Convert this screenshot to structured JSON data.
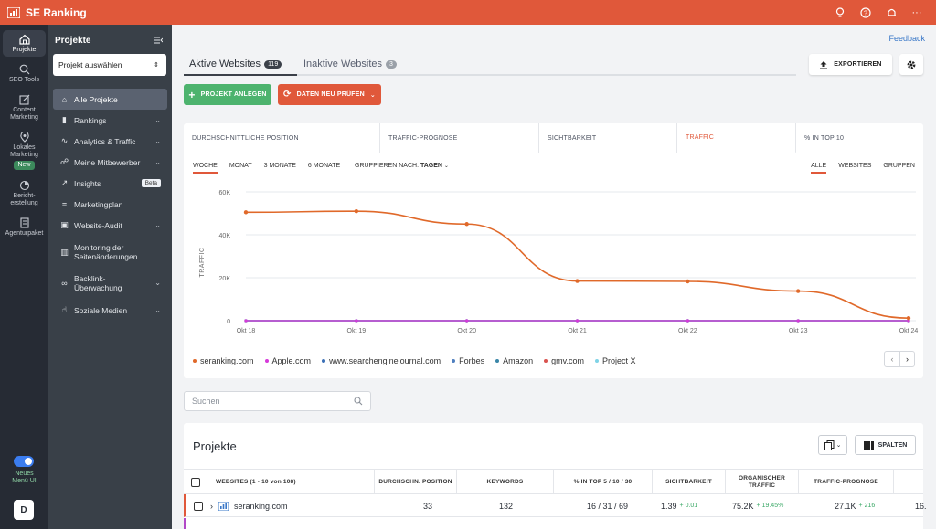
{
  "app": {
    "title": "SE Ranking"
  },
  "rail": {
    "items": [
      {
        "label": "Projekte",
        "icon": "home-icon"
      },
      {
        "label": "SEO Tools",
        "icon": "search-icon"
      },
      {
        "label": "Content Marketing",
        "icon": "edit-icon"
      },
      {
        "label": "Lokales Marketing",
        "icon": "pin-icon",
        "badge": "New"
      },
      {
        "label": "Bericht-erstellung",
        "icon": "pie-icon"
      },
      {
        "label": "Agenturpaket",
        "icon": "building-icon"
      }
    ],
    "new_ui": "Neues Menü UI",
    "avatar": "D"
  },
  "sidebar": {
    "title": "Projekte",
    "select": "Projekt auswählen",
    "items": [
      {
        "label": "Alle Projekte"
      },
      {
        "label": "Rankings"
      },
      {
        "label": "Analytics & Traffic"
      },
      {
        "label": "Meine Mitbewerber"
      },
      {
        "label": "Insights",
        "badge": "Beta"
      },
      {
        "label": "Marketingplan"
      },
      {
        "label": "Website-Audit"
      },
      {
        "label": "Monitoring der Seitenänderungen"
      },
      {
        "label": "Backlink-Überwachung"
      },
      {
        "label": "Soziale Medien"
      }
    ]
  },
  "main": {
    "feedback": "Feedback",
    "tabs": [
      {
        "label": "Aktive Websites",
        "count": "119"
      },
      {
        "label": "Inaktive Websites",
        "count": "3"
      }
    ],
    "export": "EXPORTIEREN",
    "add_project": "PROJEKT ANLEGEN",
    "recheck": "DATEN NEU PRÜFEN",
    "metric_tabs": [
      "DURCHSCHNITTLICHE POSITION",
      "TRAFFIC-PROGNOSE",
      "SICHTBARKEIT",
      "TRAFFIC",
      "% IN TOP 10"
    ],
    "periods": [
      "WOCHE",
      "MONAT",
      "3 MONATE",
      "6 MONATE"
    ],
    "group_label": "GRUPPIEREN NACH:",
    "group_value": "TAGEN",
    "views": [
      "ALLE",
      "WEBSITES",
      "GRUPPEN"
    ],
    "search_placeholder": "Suchen"
  },
  "chart_data": {
    "type": "line",
    "x": [
      "Okt 18",
      "Okt 19",
      "Okt 20",
      "Okt 21",
      "Okt 22",
      "Okt 23",
      "Okt 24"
    ],
    "ylabel": "TRAFFIC",
    "yticks": [
      "0",
      "20K",
      "40K",
      "60K"
    ],
    "ylim": [
      0,
      60000
    ],
    "grid": true,
    "legend_position": "bottom",
    "series": [
      {
        "name": "seranking.com",
        "color": "#e0692a",
        "values": [
          50500,
          51000,
          45000,
          18500,
          18300,
          13800,
          1200
        ]
      },
      {
        "name": "Apple.com",
        "color": "#d63ad9",
        "values": [
          0,
          0,
          0,
          0,
          0,
          0,
          0
        ]
      },
      {
        "name": "www.searchenginejournal.com",
        "color": "#3b6fb6",
        "values": [
          0,
          0,
          0,
          0,
          0,
          0,
          0
        ]
      },
      {
        "name": "Forbes",
        "color": "#4f7fbf",
        "values": [
          0,
          0,
          0,
          0,
          0,
          0,
          0
        ]
      },
      {
        "name": "Amazon",
        "color": "#3a86a8",
        "values": [
          0,
          0,
          0,
          0,
          0,
          0,
          0
        ]
      },
      {
        "name": "gmv.com",
        "color": "#d9534f",
        "values": [
          0,
          0,
          0,
          0,
          0,
          0,
          0
        ]
      },
      {
        "name": "Project X",
        "color": "#7fd3e6",
        "values": [
          0,
          0,
          0,
          0,
          0,
          0,
          0
        ]
      }
    ]
  },
  "table": {
    "title": "Projekte",
    "columns_btn": "SPALTEN",
    "headers": [
      "WEBSITES (1 - 10 von 108)",
      "DURCHSCHN. POSITION",
      "KEYWORDS",
      "% IN TOP 5 / 10 / 30",
      "SICHTBARKEIT",
      "ORGANISCHER TRAFFIC",
      "TRAFFIC-PROGNOSE"
    ],
    "row": {
      "site": "seranking.com",
      "position": "33",
      "keywords": "132",
      "top": "16 / 31 / 69",
      "visibility": "1.39",
      "visibility_delta": "+ 0.01",
      "traffic": "75.2K",
      "traffic_delta": "+ 19.45%",
      "forecast": "27.1K",
      "forecast_delta": "+ 216",
      "extra": "16."
    }
  }
}
